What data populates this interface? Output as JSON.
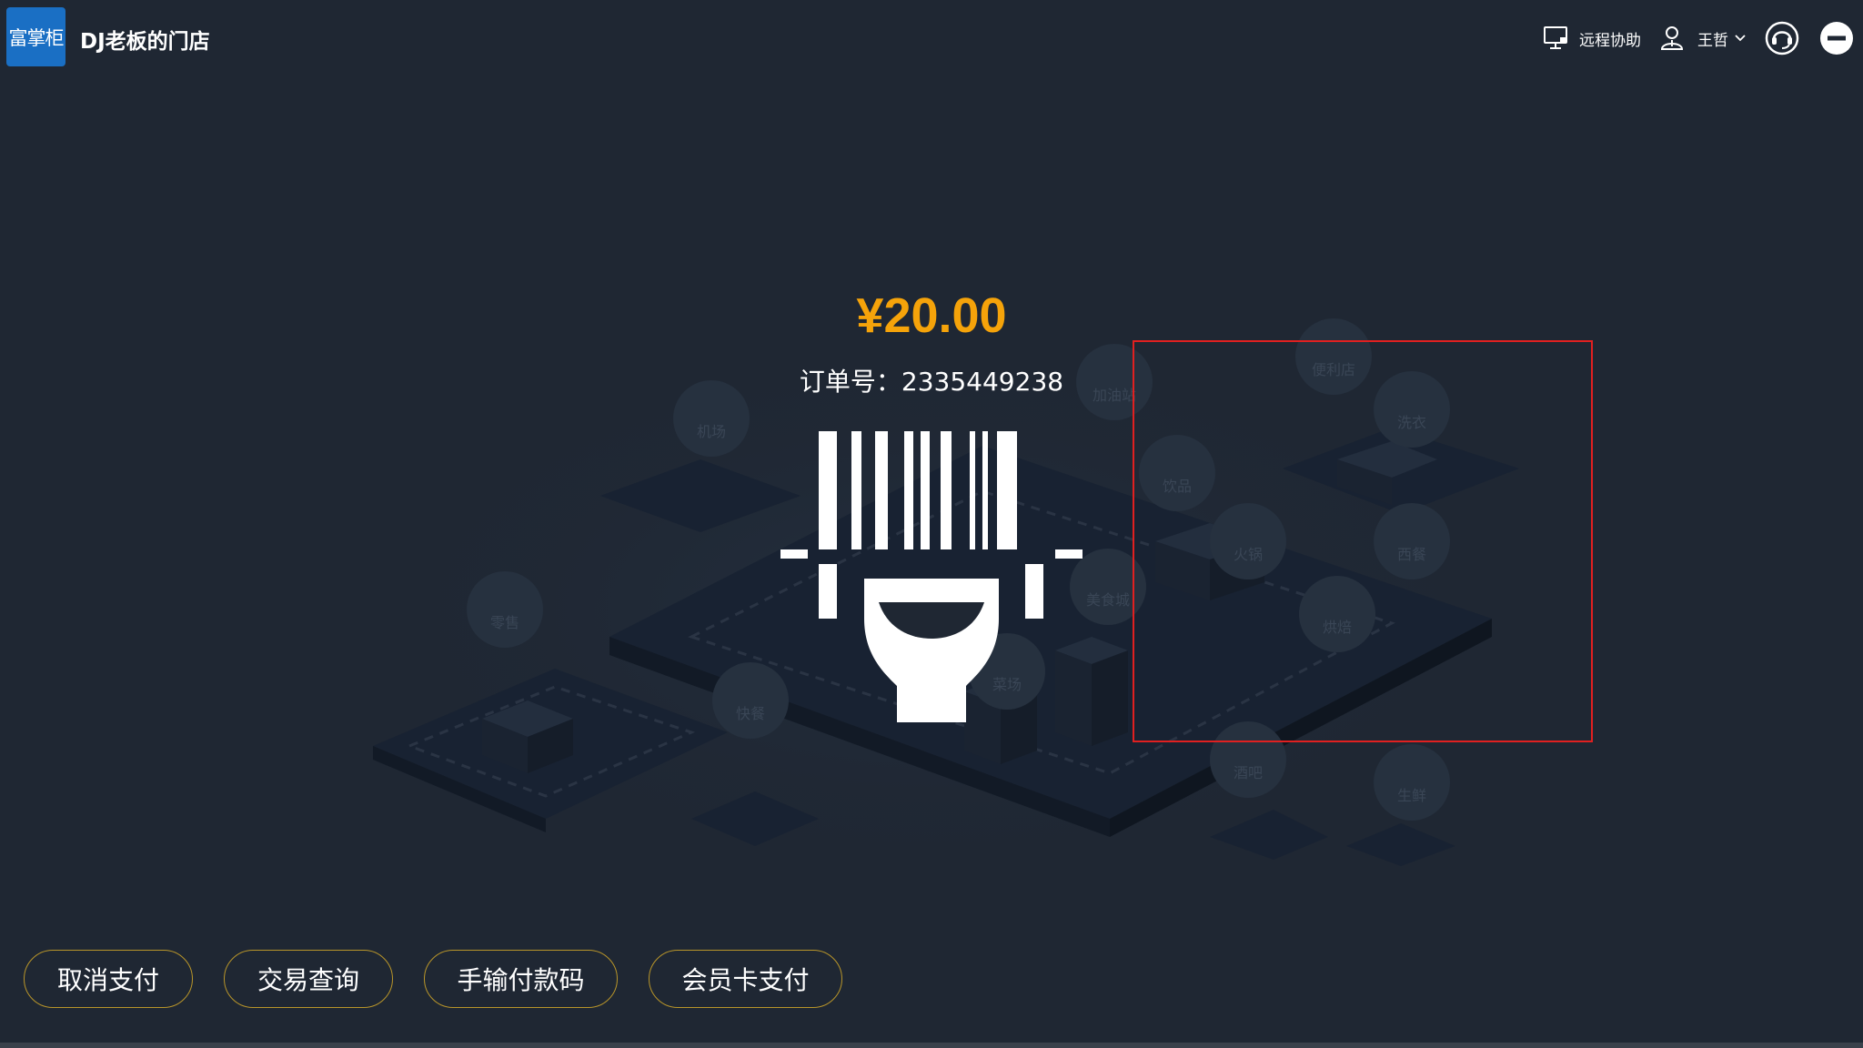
{
  "header": {
    "logo_text": "富掌柜",
    "store_name": "DJ老板的门店",
    "remote_assist_label": "远程协助",
    "user_name": "王哲",
    "icons": [
      "monitor-icon",
      "user-icon",
      "chevron-down-icon",
      "support-icon",
      "minimize-icon"
    ]
  },
  "payment": {
    "amount": "¥20.00",
    "order_label": "订单号：2335449238"
  },
  "scene_labels": [
    "机场",
    "加油站",
    "便利店",
    "洗衣",
    "饮品",
    "火锅",
    "西餐",
    "美食城",
    "烘焙",
    "零售",
    "快餐",
    "菜场",
    "酒吧",
    "生鲜"
  ],
  "buttons": {
    "cancel": "取消支付",
    "query": "交易查询",
    "manual_code": "手输付款码",
    "member_card": "会员卡支付"
  },
  "colors": {
    "background": "#1f2733",
    "amount": "#f5a30a",
    "button_border": "#b8952a",
    "highlight": "#e02020",
    "logo_bg": "#1a6fc4"
  }
}
